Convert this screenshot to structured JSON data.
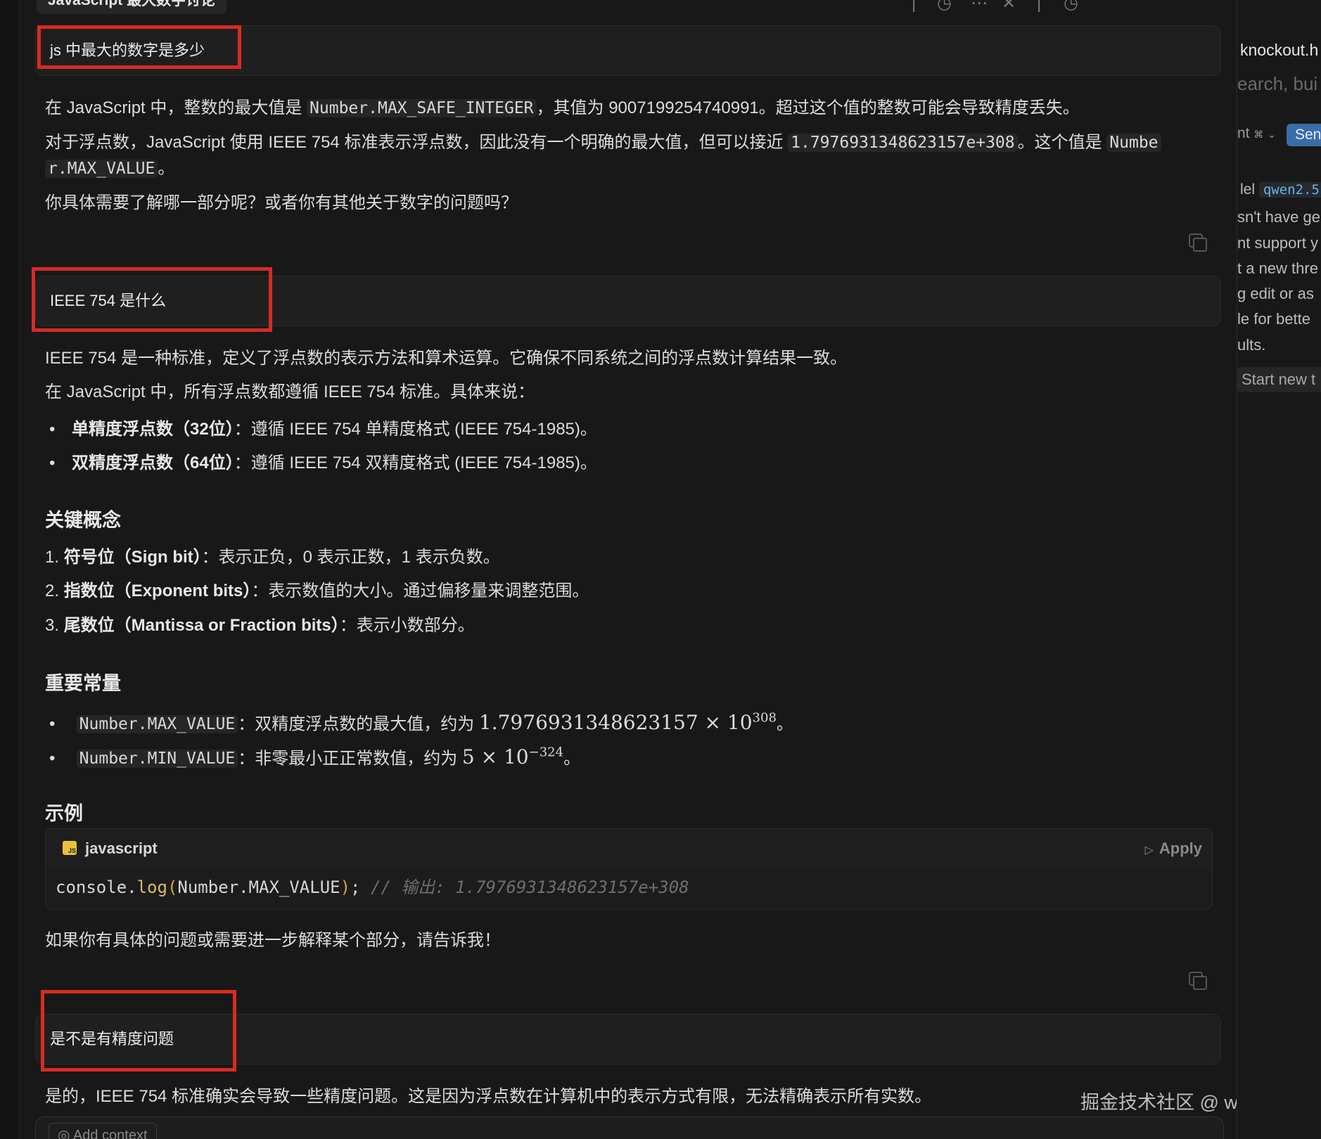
{
  "window": {
    "title": "JavaScript 最大数字讨论"
  },
  "messages": {
    "q1": "js 中最大的数字是多少",
    "a1": {
      "p1_pre": "在 JavaScript 中，整数的最大值是 ",
      "p1_code": "Number.MAX_SAFE_INTEGER",
      "p1_post": "，其值为 9007199254740991。超过这个值的整数可能会导致精度丢失。",
      "p2_pre": "对于浮点数，JavaScript 使用 IEEE 754 标准表示浮点数，因此没有一个明确的最大值，但可以接近 ",
      "p2_code": "1.7976931348623157e+308",
      "p2_mid": "。这个值是 ",
      "p2_code2a": "Numbe",
      "p2_code2b": "r.MAX_VALUE",
      "p2_post": "。",
      "p3": "你具体需要了解哪一部分呢？或者你有其他关于数字的问题吗？"
    },
    "q2": "IEEE 754 是什么",
    "a2": {
      "p1": "IEEE 754 是一种标准，定义了浮点数的表示方法和算术运算。它确保不同系统之间的浮点数计算结果一致。",
      "p2": "在 JavaScript 中，所有浮点数都遵循 IEEE 754 标准。具体来说：",
      "bullets": [
        {
          "bold": "单精度浮点数（32位）",
          "text": "：遵循 IEEE 754 单精度格式 (IEEE 754-1985)。"
        },
        {
          "bold": "双精度浮点数（64位）",
          "text": "：遵循 IEEE 754 双精度格式 (IEEE 754-1985)。"
        }
      ],
      "h_concepts": "关键概念",
      "concepts": [
        {
          "num": "1.",
          "bold": "符号位（Sign bit）",
          "text": "：表示正负，0 表示正数，1 表示负数。"
        },
        {
          "num": "2.",
          "bold": "指数位（Exponent bits）",
          "text": "：表示数值的大小。通过偏移量来调整范围。"
        },
        {
          "num": "3.",
          "bold": "尾数位（Mantissa or Fraction bits）",
          "text": "：表示小数部分。"
        }
      ],
      "h_constants": "重要常量",
      "constants": [
        {
          "code": "Number.MAX_VALUE",
          "text": "：双精度浮点数的最大值，约为 ",
          "math_base": "1.7976931348623157 × 10",
          "math_exp": "308",
          "end": "。"
        },
        {
          "code": "Number.MIN_VALUE",
          "text": "：非零最小正正常数值，约为 ",
          "math_base": "5 × 10",
          "math_exp": "−324",
          "end": "。"
        }
      ],
      "h_example": "示例",
      "code_lang": "javascript",
      "apply_label": "Apply",
      "code": {
        "obj": "console.",
        "fn": "log",
        "open": "(",
        "arg": "Number.MAX_VALUE",
        "close": ")",
        "semi": ";",
        "comment": " // 输出: 1.7976931348623157e+308"
      },
      "closing": "如果你有具体的问题或需要进一步解释某个部分，请告诉我！"
    },
    "q3": "是不是有精度问题",
    "a3": {
      "p1": "是的，IEEE 754 标准确实会导致一些精度问题。这是因为浮点数在计算机中的表示方式有限，无法精确表示所有实数。"
    }
  },
  "input": {
    "add_context": "Add context"
  },
  "watermark": "掘金技术社区 @ windliang",
  "right_panel": {
    "file_title": "knockout.h",
    "search_placeholder": "earch, bui",
    "mode_label": "nt",
    "mode_shortcut": "⌘",
    "send_label": "Sen",
    "model_prefix": "lel",
    "model_name": "qwen2.5",
    "lines": [
      "sn't have ge",
      "nt support y",
      "t a new thre",
      "g edit or as",
      "le for bette",
      "ults."
    ],
    "start_new": "Start new t"
  },
  "colors": {
    "background": "#181818",
    "highlight_box": "#d62b22",
    "send_button": "#3a6da8",
    "js_icon": "#e8c23a"
  },
  "icons": [
    "history-icon",
    "more-icon",
    "close-icon",
    "copy-icon",
    "js-file-icon",
    "play-icon"
  ]
}
